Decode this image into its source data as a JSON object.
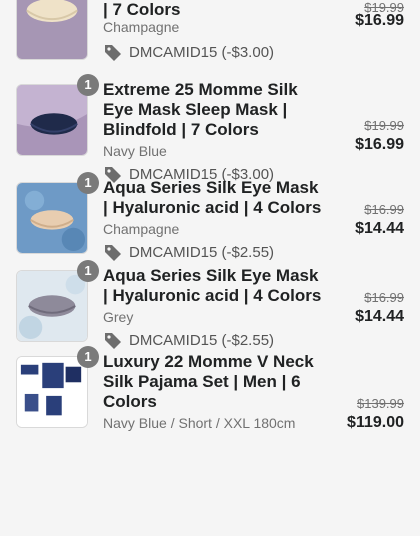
{
  "items": [
    {
      "title": "| 7 Colors",
      "variant": "Champagne",
      "quantity": "",
      "old_price": "$19.99",
      "new_price": "$16.99",
      "discount": "DMCAMID15 (-$3.00)",
      "image": "eye-mask-champagne"
    },
    {
      "title": "Extreme 25 Momme Silk Eye Mask Sleep Mask | Blindfold | 7 Colors",
      "variant": "Navy Blue",
      "quantity": "1",
      "old_price": "$19.99",
      "new_price": "$16.99",
      "discount": "DMCAMID15 (-$3.00)",
      "image": "eye-mask-navy"
    },
    {
      "title": "Aqua Series Silk Eye Mask | Hyaluronic acid | 4 Colors",
      "variant": "Champagne",
      "quantity": "1",
      "old_price": "$16.99",
      "new_price": "$14.44",
      "discount": "DMCAMID15 (-$2.55)",
      "image": "eye-mask-aqua-champagne"
    },
    {
      "title": "Aqua Series Silk Eye Mask | Hyaluronic acid | 4 Colors",
      "variant": "Grey",
      "quantity": "1",
      "old_price": "$16.99",
      "new_price": "$14.44",
      "discount": "DMCAMID15 (-$2.55)",
      "image": "eye-mask-aqua-grey"
    },
    {
      "title": "Luxury 22 Momme V Neck Silk Pajama Set | Men | 6 Colors",
      "variant": "Navy Blue / Short / XXL 180cm",
      "quantity": "1",
      "old_price": "$139.99",
      "new_price": "$119.00",
      "discount": "",
      "image": "pajama-set-navy"
    }
  ]
}
